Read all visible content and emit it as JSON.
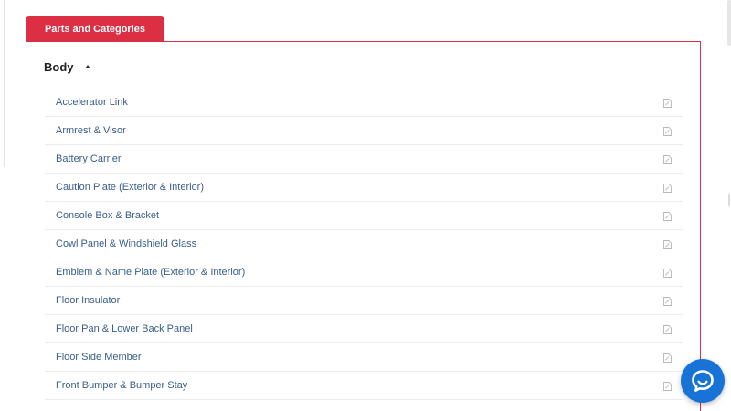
{
  "tab": {
    "label": "Parts and Categories"
  },
  "section": {
    "title": "Body",
    "expanded": true
  },
  "items": [
    {
      "label": "Accelerator Link",
      "icon": "edit-note-icon"
    },
    {
      "label": "Armrest & Visor",
      "icon": "edit-note-icon"
    },
    {
      "label": "Battery Carrier",
      "icon": "edit-note-icon"
    },
    {
      "label": "Caution Plate (Exterior & Interior)",
      "icon": "edit-note-icon"
    },
    {
      "label": "Console Box & Bracket",
      "icon": "edit-note-icon"
    },
    {
      "label": "Cowl Panel & Windshield Glass",
      "icon": "edit-note-icon"
    },
    {
      "label": "Emblem & Name Plate (Exterior & Interior)",
      "icon": "edit-note-icon"
    },
    {
      "label": "Floor Insulator",
      "icon": "edit-note-icon"
    },
    {
      "label": "Floor Pan & Lower Back Panel",
      "icon": "edit-note-icon"
    },
    {
      "label": "Floor Side Member",
      "icon": "edit-note-icon"
    },
    {
      "label": "Front Bumper & Bumper Stay",
      "icon": "edit-note-icon"
    }
  ],
  "chat": {
    "icon": "chat-bubble-icon"
  },
  "colors": {
    "accent": "#dc2f43",
    "link": "#3a5d89",
    "chat": "#1773d6"
  }
}
